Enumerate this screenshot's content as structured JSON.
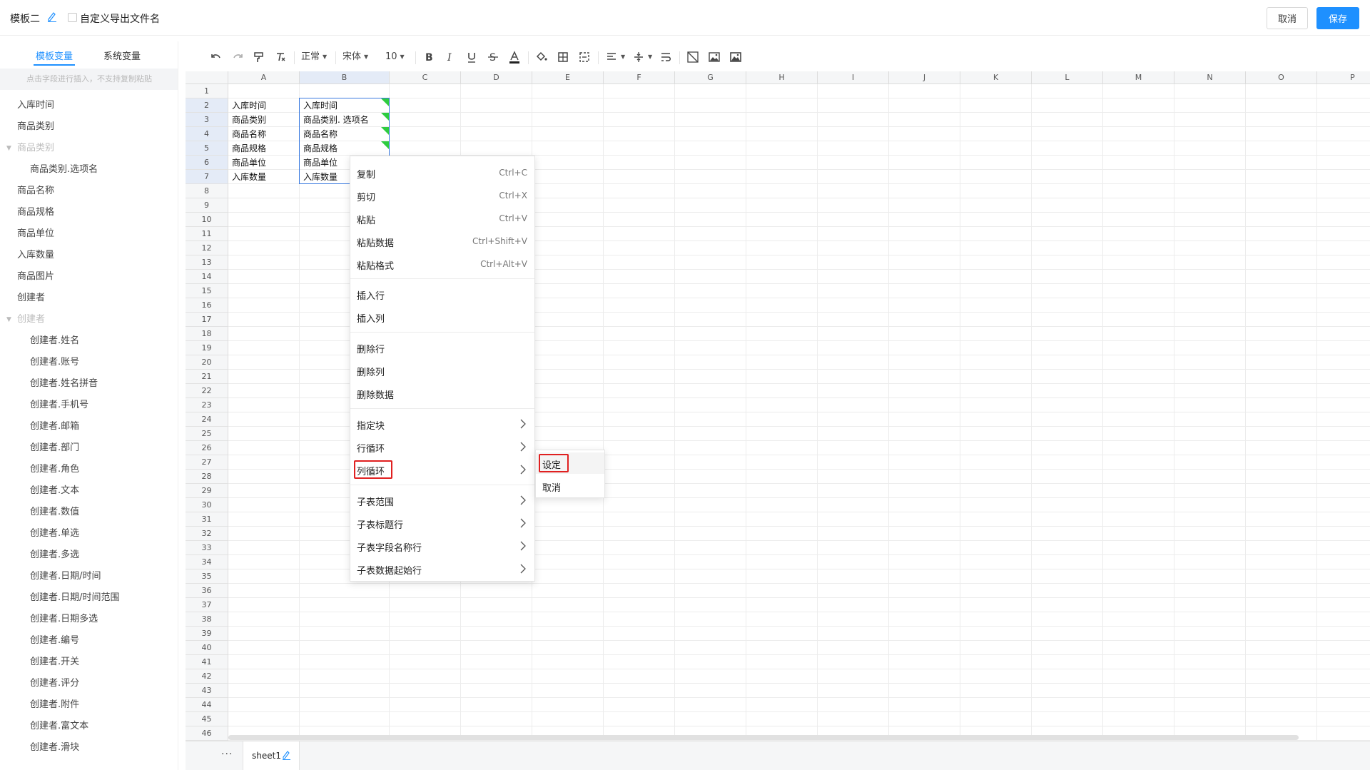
{
  "header": {
    "template_name": "模板二",
    "custom_export_label": "自定义导出文件名",
    "cancel_label": "取消",
    "save_label": "保存"
  },
  "left_panel": {
    "tabs": [
      {
        "label": "模板变量",
        "active": true
      },
      {
        "label": "系统变量",
        "active": false
      }
    ],
    "hint": "点击字段进行插入，不支持复制粘贴",
    "items": [
      {
        "label": "入库时间",
        "kind": "item"
      },
      {
        "label": "商品类别",
        "kind": "item"
      },
      {
        "label": "商品类别",
        "kind": "group"
      },
      {
        "label": "商品类别.选项名",
        "kind": "child"
      },
      {
        "label": "商品名称",
        "kind": "item"
      },
      {
        "label": "商品规格",
        "kind": "item"
      },
      {
        "label": "商品单位",
        "kind": "item"
      },
      {
        "label": "入库数量",
        "kind": "item"
      },
      {
        "label": "商品图片",
        "kind": "item"
      },
      {
        "label": "创建者",
        "kind": "item"
      },
      {
        "label": "创建者",
        "kind": "group"
      },
      {
        "label": "创建者.姓名",
        "kind": "child"
      },
      {
        "label": "创建者.账号",
        "kind": "child"
      },
      {
        "label": "创建者.姓名拼音",
        "kind": "child"
      },
      {
        "label": "创建者.手机号",
        "kind": "child"
      },
      {
        "label": "创建者.邮箱",
        "kind": "child"
      },
      {
        "label": "创建者.部门",
        "kind": "child"
      },
      {
        "label": "创建者.角色",
        "kind": "child"
      },
      {
        "label": "创建者.文本",
        "kind": "child"
      },
      {
        "label": "创建者.数值",
        "kind": "child"
      },
      {
        "label": "创建者.单选",
        "kind": "child"
      },
      {
        "label": "创建者.多选",
        "kind": "child"
      },
      {
        "label": "创建者.日期/时间",
        "kind": "child"
      },
      {
        "label": "创建者.日期/时间范围",
        "kind": "child"
      },
      {
        "label": "创建者.日期多选",
        "kind": "child"
      },
      {
        "label": "创建者.编号",
        "kind": "child"
      },
      {
        "label": "创建者.开关",
        "kind": "child"
      },
      {
        "label": "创建者.评分",
        "kind": "child"
      },
      {
        "label": "创建者.附件",
        "kind": "child"
      },
      {
        "label": "创建者.富文本",
        "kind": "child"
      },
      {
        "label": "创建者.滑块",
        "kind": "child"
      }
    ]
  },
  "toolbar": {
    "style_select": "正常",
    "font_select": "宋体",
    "size_select": "10"
  },
  "sheet": {
    "columns": [
      "A",
      "B",
      "C",
      "D",
      "E",
      "F",
      "G",
      "H",
      "I",
      "J",
      "K",
      "L",
      "M",
      "N",
      "O",
      "P"
    ],
    "row_count": 46,
    "cells": [
      {
        "row": 2,
        "col": "A",
        "text": "入库时间"
      },
      {
        "row": 3,
        "col": "A",
        "text": "商品类别"
      },
      {
        "row": 4,
        "col": "A",
        "text": "商品名称"
      },
      {
        "row": 5,
        "col": "A",
        "text": "商品规格"
      },
      {
        "row": 6,
        "col": "A",
        "text": "商品单位"
      },
      {
        "row": 7,
        "col": "A",
        "text": "入库数量"
      },
      {
        "row": 2,
        "col": "B",
        "text": "入库时间"
      },
      {
        "row": 3,
        "col": "B",
        "text": "商品类别. 选项名"
      },
      {
        "row": 4,
        "col": "B",
        "text": "商品名称"
      },
      {
        "row": 5,
        "col": "B",
        "text": "商品规格"
      },
      {
        "row": 6,
        "col": "B",
        "text": "商品单位"
      },
      {
        "row": 7,
        "col": "B",
        "text": "入库数量"
      }
    ],
    "tab_name": "sheet1",
    "more_label": "···"
  },
  "context_menu": {
    "items": [
      {
        "label": "复制",
        "shortcut": "Ctrl+C"
      },
      {
        "label": "剪切",
        "shortcut": "Ctrl+X"
      },
      {
        "label": "粘贴",
        "shortcut": "Ctrl+V"
      },
      {
        "label": "粘贴数据",
        "shortcut": "Ctrl+Shift+V"
      },
      {
        "label": "粘贴格式",
        "shortcut": "Ctrl+Alt+V"
      },
      {
        "label": "插入行",
        "shortcut": ""
      },
      {
        "label": "插入列",
        "shortcut": ""
      },
      {
        "label": "删除行",
        "shortcut": ""
      },
      {
        "label": "删除列",
        "shortcut": ""
      },
      {
        "label": "删除数据",
        "shortcut": ""
      },
      {
        "label": "指定块",
        "submenu": true
      },
      {
        "label": "行循环",
        "submenu": true
      },
      {
        "label": "列循环",
        "submenu": true,
        "highlighted": true
      },
      {
        "label": "子表范围",
        "submenu": true
      },
      {
        "label": "子表标题行",
        "submenu": true
      },
      {
        "label": "子表字段名称行",
        "submenu": true
      },
      {
        "label": "子表数据起始行",
        "submenu": true
      }
    ],
    "submenu": [
      {
        "label": "设定",
        "highlighted": true
      },
      {
        "label": "取消"
      }
    ]
  },
  "colors": {
    "accent": "#1e90ff",
    "selection": "#3a7ae0",
    "marker_green": "#2ecc40",
    "highlight_red": "#e02020"
  }
}
